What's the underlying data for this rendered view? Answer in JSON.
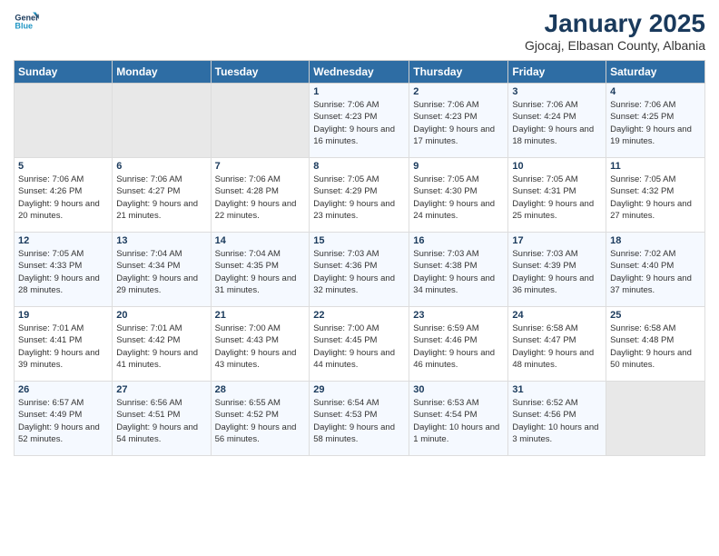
{
  "logo": {
    "line1": "General",
    "line2": "Blue"
  },
  "title": "January 2025",
  "subtitle": "Gjocaj, Elbasan County, Albania",
  "days_header": [
    "Sunday",
    "Monday",
    "Tuesday",
    "Wednesday",
    "Thursday",
    "Friday",
    "Saturday"
  ],
  "weeks": [
    [
      {
        "num": "",
        "content": ""
      },
      {
        "num": "",
        "content": ""
      },
      {
        "num": "",
        "content": ""
      },
      {
        "num": "1",
        "content": "Sunrise: 7:06 AM\nSunset: 4:23 PM\nDaylight: 9 hours and 16 minutes."
      },
      {
        "num": "2",
        "content": "Sunrise: 7:06 AM\nSunset: 4:23 PM\nDaylight: 9 hours and 17 minutes."
      },
      {
        "num": "3",
        "content": "Sunrise: 7:06 AM\nSunset: 4:24 PM\nDaylight: 9 hours and 18 minutes."
      },
      {
        "num": "4",
        "content": "Sunrise: 7:06 AM\nSunset: 4:25 PM\nDaylight: 9 hours and 19 minutes."
      }
    ],
    [
      {
        "num": "5",
        "content": "Sunrise: 7:06 AM\nSunset: 4:26 PM\nDaylight: 9 hours and 20 minutes."
      },
      {
        "num": "6",
        "content": "Sunrise: 7:06 AM\nSunset: 4:27 PM\nDaylight: 9 hours and 21 minutes."
      },
      {
        "num": "7",
        "content": "Sunrise: 7:06 AM\nSunset: 4:28 PM\nDaylight: 9 hours and 22 minutes."
      },
      {
        "num": "8",
        "content": "Sunrise: 7:05 AM\nSunset: 4:29 PM\nDaylight: 9 hours and 23 minutes."
      },
      {
        "num": "9",
        "content": "Sunrise: 7:05 AM\nSunset: 4:30 PM\nDaylight: 9 hours and 24 minutes."
      },
      {
        "num": "10",
        "content": "Sunrise: 7:05 AM\nSunset: 4:31 PM\nDaylight: 9 hours and 25 minutes."
      },
      {
        "num": "11",
        "content": "Sunrise: 7:05 AM\nSunset: 4:32 PM\nDaylight: 9 hours and 27 minutes."
      }
    ],
    [
      {
        "num": "12",
        "content": "Sunrise: 7:05 AM\nSunset: 4:33 PM\nDaylight: 9 hours and 28 minutes."
      },
      {
        "num": "13",
        "content": "Sunrise: 7:04 AM\nSunset: 4:34 PM\nDaylight: 9 hours and 29 minutes."
      },
      {
        "num": "14",
        "content": "Sunrise: 7:04 AM\nSunset: 4:35 PM\nDaylight: 9 hours and 31 minutes."
      },
      {
        "num": "15",
        "content": "Sunrise: 7:03 AM\nSunset: 4:36 PM\nDaylight: 9 hours and 32 minutes."
      },
      {
        "num": "16",
        "content": "Sunrise: 7:03 AM\nSunset: 4:38 PM\nDaylight: 9 hours and 34 minutes."
      },
      {
        "num": "17",
        "content": "Sunrise: 7:03 AM\nSunset: 4:39 PM\nDaylight: 9 hours and 36 minutes."
      },
      {
        "num": "18",
        "content": "Sunrise: 7:02 AM\nSunset: 4:40 PM\nDaylight: 9 hours and 37 minutes."
      }
    ],
    [
      {
        "num": "19",
        "content": "Sunrise: 7:01 AM\nSunset: 4:41 PM\nDaylight: 9 hours and 39 minutes."
      },
      {
        "num": "20",
        "content": "Sunrise: 7:01 AM\nSunset: 4:42 PM\nDaylight: 9 hours and 41 minutes."
      },
      {
        "num": "21",
        "content": "Sunrise: 7:00 AM\nSunset: 4:43 PM\nDaylight: 9 hours and 43 minutes."
      },
      {
        "num": "22",
        "content": "Sunrise: 7:00 AM\nSunset: 4:45 PM\nDaylight: 9 hours and 44 minutes."
      },
      {
        "num": "23",
        "content": "Sunrise: 6:59 AM\nSunset: 4:46 PM\nDaylight: 9 hours and 46 minutes."
      },
      {
        "num": "24",
        "content": "Sunrise: 6:58 AM\nSunset: 4:47 PM\nDaylight: 9 hours and 48 minutes."
      },
      {
        "num": "25",
        "content": "Sunrise: 6:58 AM\nSunset: 4:48 PM\nDaylight: 9 hours and 50 minutes."
      }
    ],
    [
      {
        "num": "26",
        "content": "Sunrise: 6:57 AM\nSunset: 4:49 PM\nDaylight: 9 hours and 52 minutes."
      },
      {
        "num": "27",
        "content": "Sunrise: 6:56 AM\nSunset: 4:51 PM\nDaylight: 9 hours and 54 minutes."
      },
      {
        "num": "28",
        "content": "Sunrise: 6:55 AM\nSunset: 4:52 PM\nDaylight: 9 hours and 56 minutes."
      },
      {
        "num": "29",
        "content": "Sunrise: 6:54 AM\nSunset: 4:53 PM\nDaylight: 9 hours and 58 minutes."
      },
      {
        "num": "30",
        "content": "Sunrise: 6:53 AM\nSunset: 4:54 PM\nDaylight: 10 hours and 1 minute."
      },
      {
        "num": "31",
        "content": "Sunrise: 6:52 AM\nSunset: 4:56 PM\nDaylight: 10 hours and 3 minutes."
      },
      {
        "num": "",
        "content": ""
      }
    ]
  ]
}
